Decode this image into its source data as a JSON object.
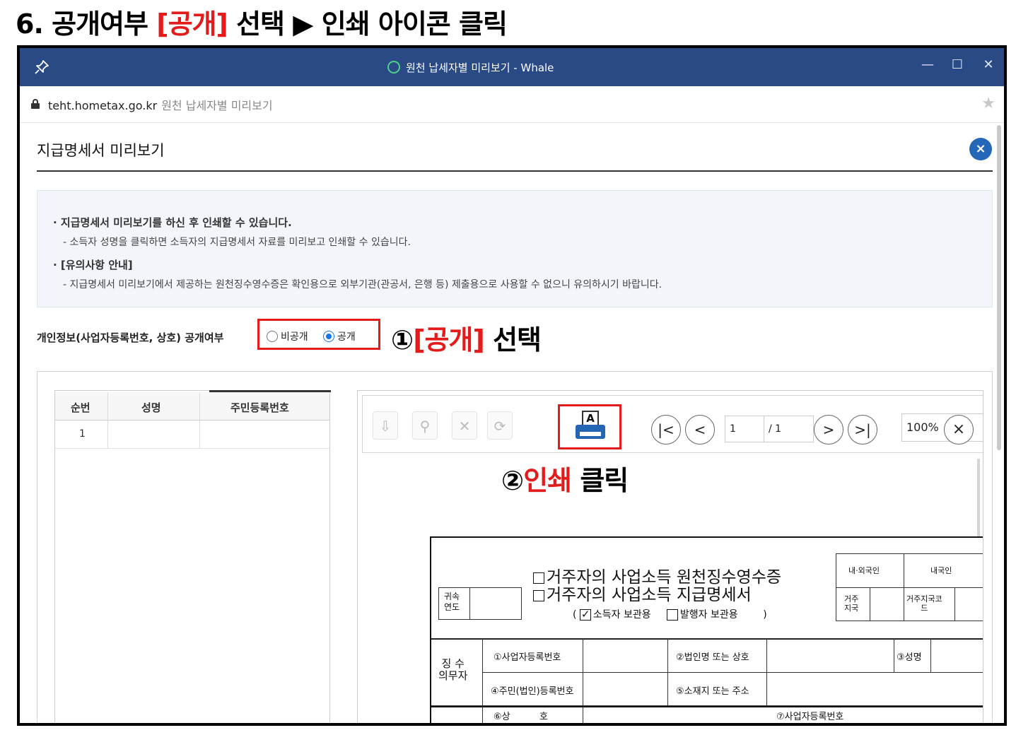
{
  "guide": {
    "step": "6.",
    "part1": "공개여부",
    "bracket": "[공개]",
    "part2": "선택",
    "arrow": "▶",
    "part3": "인쇄 아이콘 클릭"
  },
  "window": {
    "title": "원천 납세자별 미리보기 - Whale",
    "controls": {
      "minimize": "—",
      "maximize": "☐",
      "close": "✕"
    }
  },
  "address": {
    "url": "teht.hometax.go.kr",
    "page_name": "원천 납세자별 미리보기"
  },
  "modal": {
    "title": "지급명세서 미리보기",
    "close": "×"
  },
  "info": {
    "bullet1": "· 지급명세서 미리보기를 하신 후 인쇄할 수 있습니다.",
    "sub1": "- 소득자 성명을 클릭하면 소득자의 지급명세서 자료를 미리보고 인쇄할 수 있습니다.",
    "bullet2": "· [유의사항 안내]",
    "sub2": "- 지급명세서 미리보기에서 제공하는 원천징수영수증은 확인용으로 외부기관(관공서, 은행 등) 제출용으로 사용할 수 없으니 유의하시기 바랍니다."
  },
  "privacy": {
    "label": "개인정보(사업자등록번호, 상호) 공개여부",
    "options": [
      "비공개",
      "공개"
    ],
    "selected": "공개"
  },
  "annotations": {
    "step1_num": "①",
    "step1_red": "[공개]",
    "step1_text": "선택",
    "step2_num": "②",
    "step2_red": "인쇄",
    "step2_text": "클릭"
  },
  "list": {
    "columns": [
      "순번",
      "성명",
      "주민등록번호"
    ],
    "rows": [
      {
        "no": "1",
        "name": "",
        "rrn": ""
      }
    ]
  },
  "viewer": {
    "print_letter": "A",
    "page_current": "1",
    "page_total": "/ 1",
    "zoom": "100%",
    "nav": {
      "first": "|<",
      "prev": "<",
      "next": ">",
      "last": ">|",
      "close": "×"
    }
  },
  "document": {
    "title_line1": "거주자의 사업소득 원천징수영수증",
    "title_line2": "거주자의 사업소득 지급명세서",
    "keep_open": "(",
    "keep_payee": "소득자 보관용",
    "keep_payer": "발행자 보관용",
    "keep_close": ")",
    "year_label": "귀속\n연도",
    "right_hdr1": "내·외국인",
    "right_hdr2": "내국인",
    "right_hdr3": "거주\n지국",
    "right_hdr4": "거주지국코\n드",
    "withholder": "징 수\n의무자",
    "f1": "①사업자등록번호",
    "f2": "②법인명 또는 상호",
    "f3": "③성명",
    "f4": "④주민(법인)등록번호",
    "f5": "⑤소재지 또는 주소",
    "f6": "⑥상          호",
    "f7": "⑦사업자등록번호"
  },
  "colors": {
    "titlebar": "#2a4a86",
    "highlight": "#e31b1b",
    "accent": "#2467b8"
  }
}
